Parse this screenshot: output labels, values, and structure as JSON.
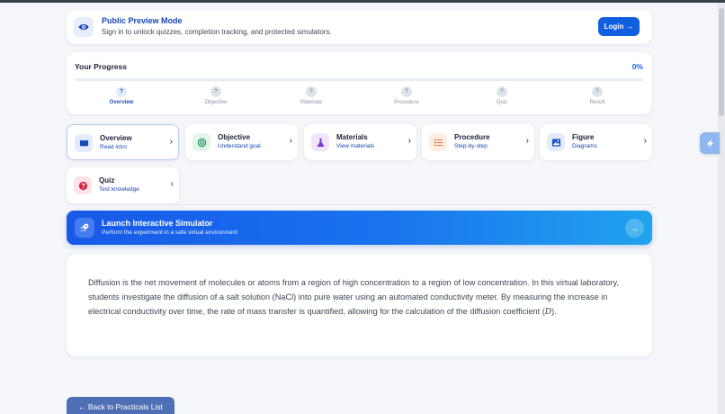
{
  "preview": {
    "title": "Public Preview Mode",
    "subtitle": "Sign in to unlock quizzes, completion tracking, and protected simulators.",
    "login_label": "Login",
    "login_icon": "arrow-right-icon"
  },
  "progress": {
    "title": "Your Progress",
    "percent_label": "0%",
    "percent_value": 0,
    "steps": [
      {
        "label": "Overview",
        "marker": "?",
        "active": true
      },
      {
        "label": "Objective",
        "marker": "?",
        "active": false
      },
      {
        "label": "Materials",
        "marker": "?",
        "active": false
      },
      {
        "label": "Procedure",
        "marker": "?",
        "active": false
      },
      {
        "label": "Quiz",
        "marker": "?",
        "active": false
      },
      {
        "label": "Result",
        "marker": "?",
        "active": false
      }
    ]
  },
  "sections": [
    {
      "title": "Overview",
      "subtitle": "Read intro",
      "icon": "book-icon",
      "icon_color": "#1747b8",
      "icon_bg": "#e3ecfb",
      "selected": true
    },
    {
      "title": "Objective",
      "subtitle": "Understand goal",
      "icon": "target-icon",
      "icon_color": "#14915a",
      "icon_bg": "#e1f5ea",
      "selected": false
    },
    {
      "title": "Materials",
      "subtitle": "View materials",
      "icon": "flask-icon",
      "icon_color": "#7b3ad1",
      "icon_bg": "#efe6fb",
      "selected": false
    },
    {
      "title": "Procedure",
      "subtitle": "Step-by-step",
      "icon": "list-icon",
      "icon_color": "#e2662a",
      "icon_bg": "#fdeee3",
      "selected": false
    },
    {
      "title": "Figure",
      "subtitle": "Diagrams",
      "icon": "image-icon",
      "icon_color": "#1d56c8",
      "icon_bg": "#e3ecfb",
      "selected": false
    },
    {
      "title": "Quiz",
      "subtitle": "Test knowledge",
      "icon": "question-icon",
      "icon_color": "#d62243",
      "icon_bg": "#fde3e8",
      "selected": false
    }
  ],
  "launch": {
    "title": "Launch Interactive Simulator",
    "subtitle": "Perform the experiment in a safe virtual environment",
    "icon": "rocket-icon"
  },
  "description": {
    "text": "Diffusion is the net movement of molecules or atoms from a region of high concentration to a region of low concentration. In this virtual laboratory, students investigate the diffusion of a salt solution (NaCl) into pure water using an automated conductivity meter. By measuring the increase in electrical conductivity over time, the rate of mass transfer is quantified, allowing for the calculation of the diffusion coefficient (",
    "symbol": "D",
    "tail": ")."
  },
  "back_label": "← Back to Practicals List",
  "colors": {
    "accent": "#1265e6",
    "brand_dark": "#1747b8",
    "background": "#f4f6fa"
  }
}
